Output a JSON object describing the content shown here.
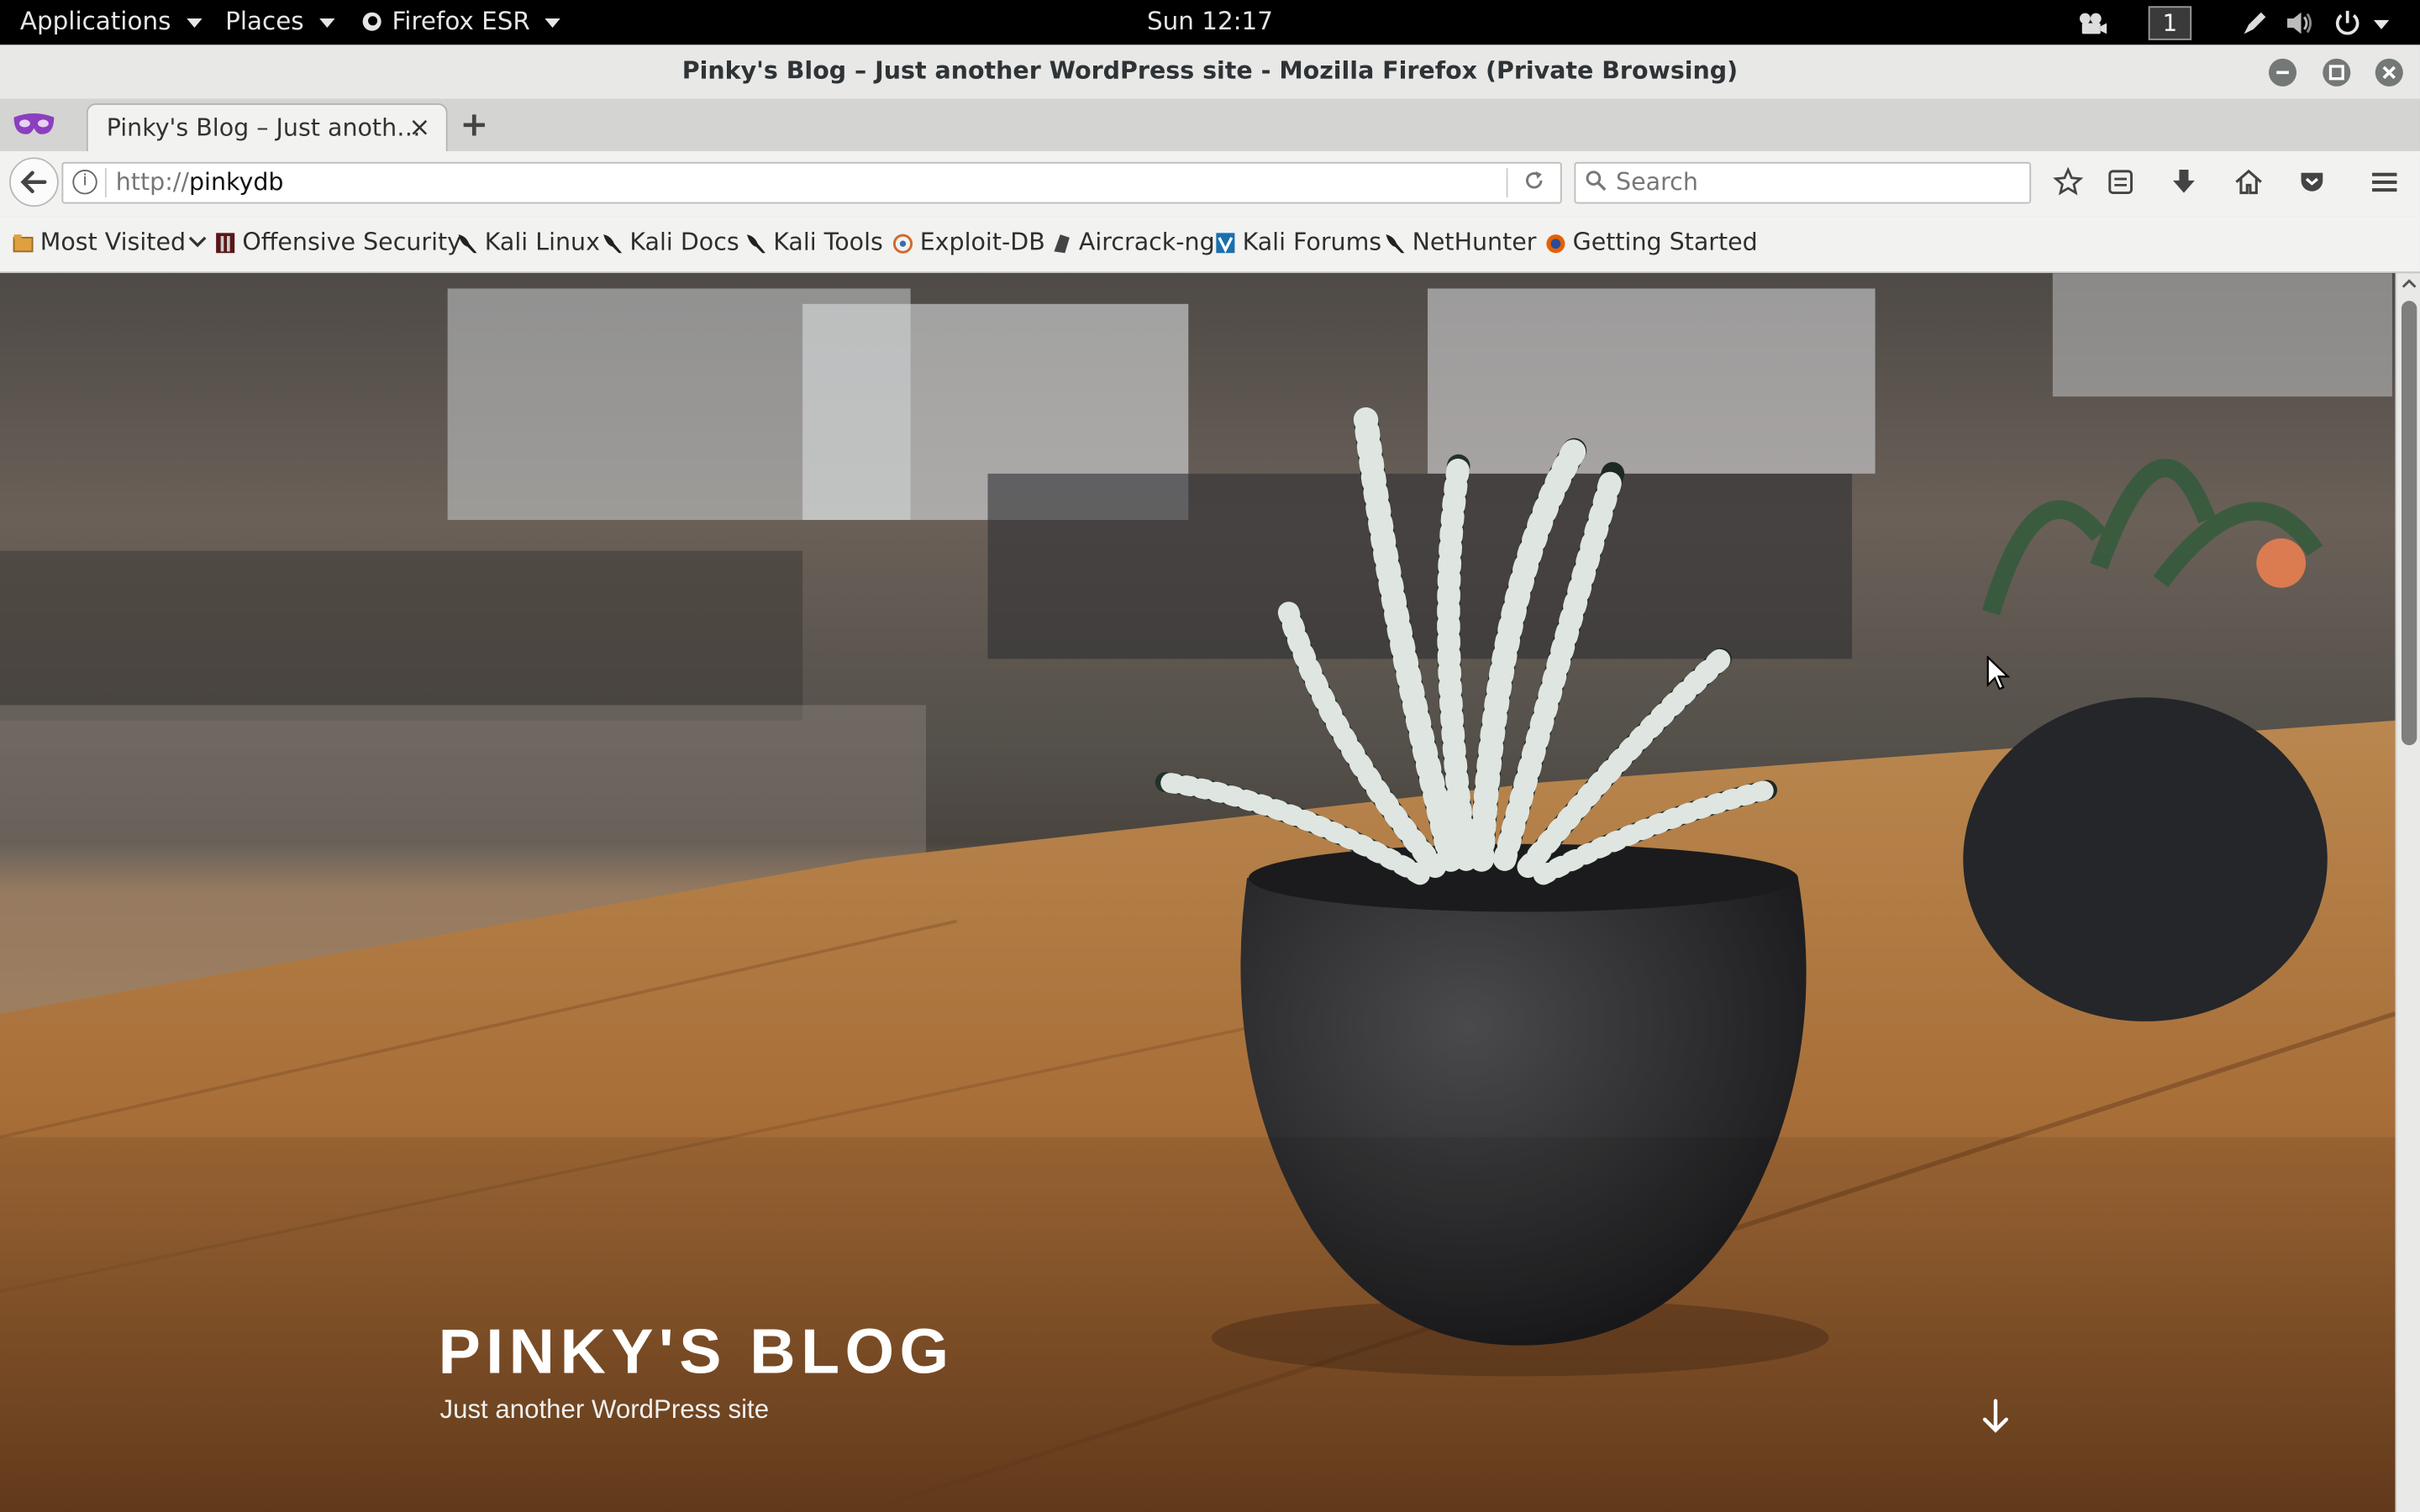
{
  "topbar": {
    "applications": "Applications",
    "places": "Places",
    "firefox_app": "Firefox ESR",
    "clock": "Sun 12:17",
    "workspace": "1"
  },
  "window": {
    "title": "Pinky's Blog – Just another WordPress site - Mozilla Firefox (Private Browsing)"
  },
  "tab": {
    "title": "Pinky's Blog – Just anoth…",
    "close": "×",
    "new_tab": "+"
  },
  "navbar": {
    "url_scheme": "http://",
    "url_host": "pinkydb",
    "search_placeholder": "Search"
  },
  "bookmarks": [
    {
      "label": "Most Visited",
      "icon": "folder-icon"
    },
    {
      "label": "Offensive Security",
      "icon": "offsec-icon"
    },
    {
      "label": "Kali Linux",
      "icon": "kali-icon"
    },
    {
      "label": "Kali Docs",
      "icon": "kali-icon"
    },
    {
      "label": "Kali Tools",
      "icon": "kali-icon"
    },
    {
      "label": "Exploit-DB",
      "icon": "exploitdb-icon"
    },
    {
      "label": "Aircrack-ng",
      "icon": "aircrack-icon"
    },
    {
      "label": "Kali Forums",
      "icon": "kali-forums-icon"
    },
    {
      "label": "NetHunter",
      "icon": "kali-icon"
    },
    {
      "label": "Getting Started",
      "icon": "firefox-icon"
    }
  ],
  "page": {
    "site_title": "PINKY'S BLOG",
    "tagline": "Just another WordPress site"
  },
  "colors": {
    "topbar_bg": "#000000",
    "chrome_bg": "#f2f2f1",
    "title_text": "#ffffff"
  }
}
